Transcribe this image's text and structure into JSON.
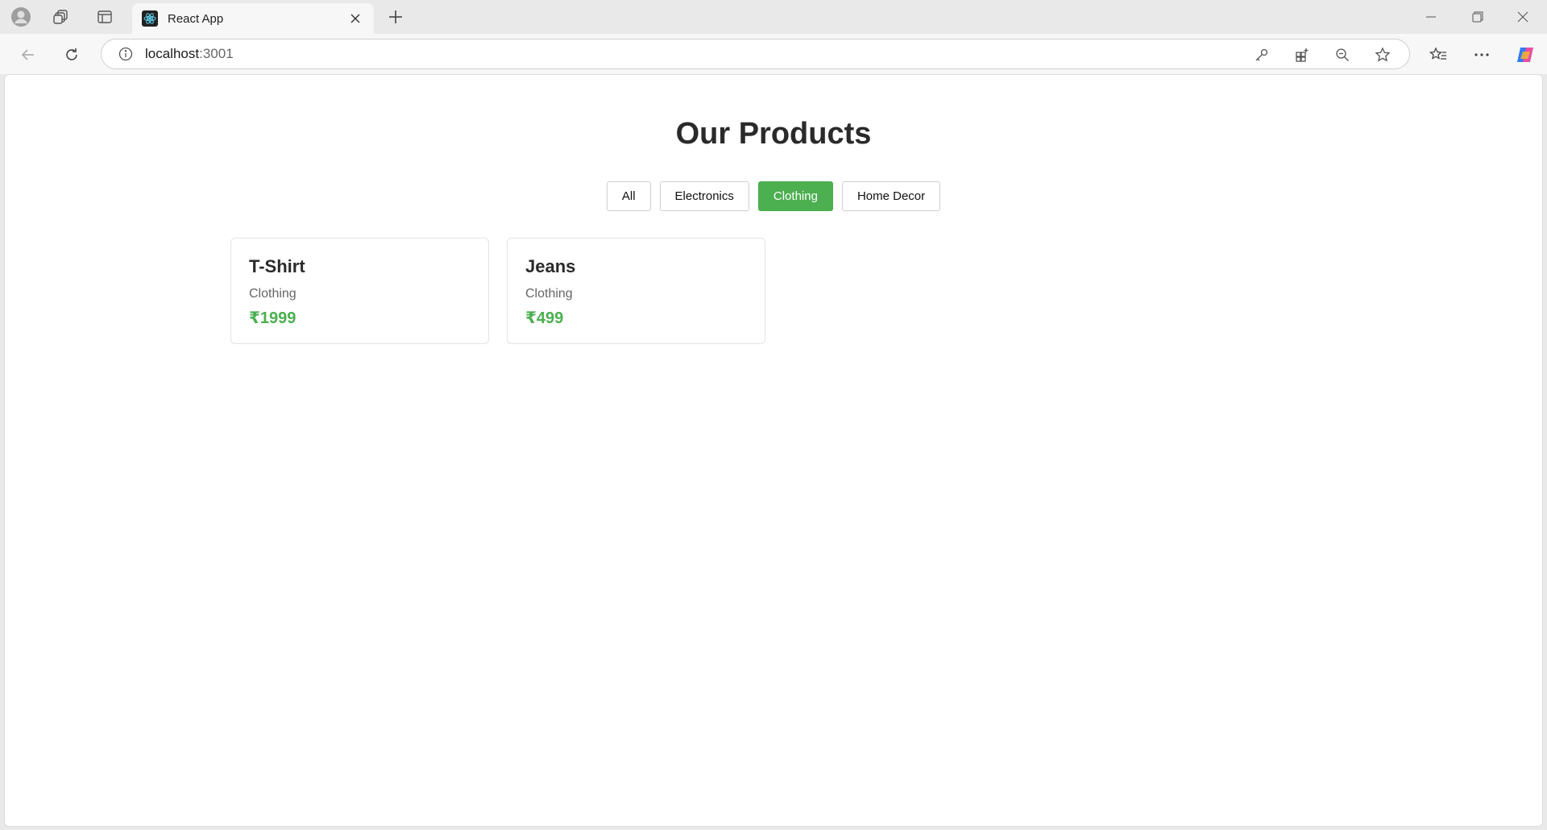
{
  "browser": {
    "tab_title": "React App",
    "address_host": "localhost",
    "address_port": ":3001"
  },
  "page": {
    "title": "Our Products",
    "filters": [
      {
        "label": "All",
        "active": false
      },
      {
        "label": "Electronics",
        "active": false
      },
      {
        "label": "Clothing",
        "active": true
      },
      {
        "label": "Home Decor",
        "active": false
      }
    ],
    "products": [
      {
        "name": "T-Shirt",
        "category": "Clothing",
        "price": "₹1999"
      },
      {
        "name": "Jeans",
        "category": "Clothing",
        "price": "₹499"
      }
    ]
  },
  "colors": {
    "accent": "#4caf50",
    "text": "#2a2a2a"
  }
}
